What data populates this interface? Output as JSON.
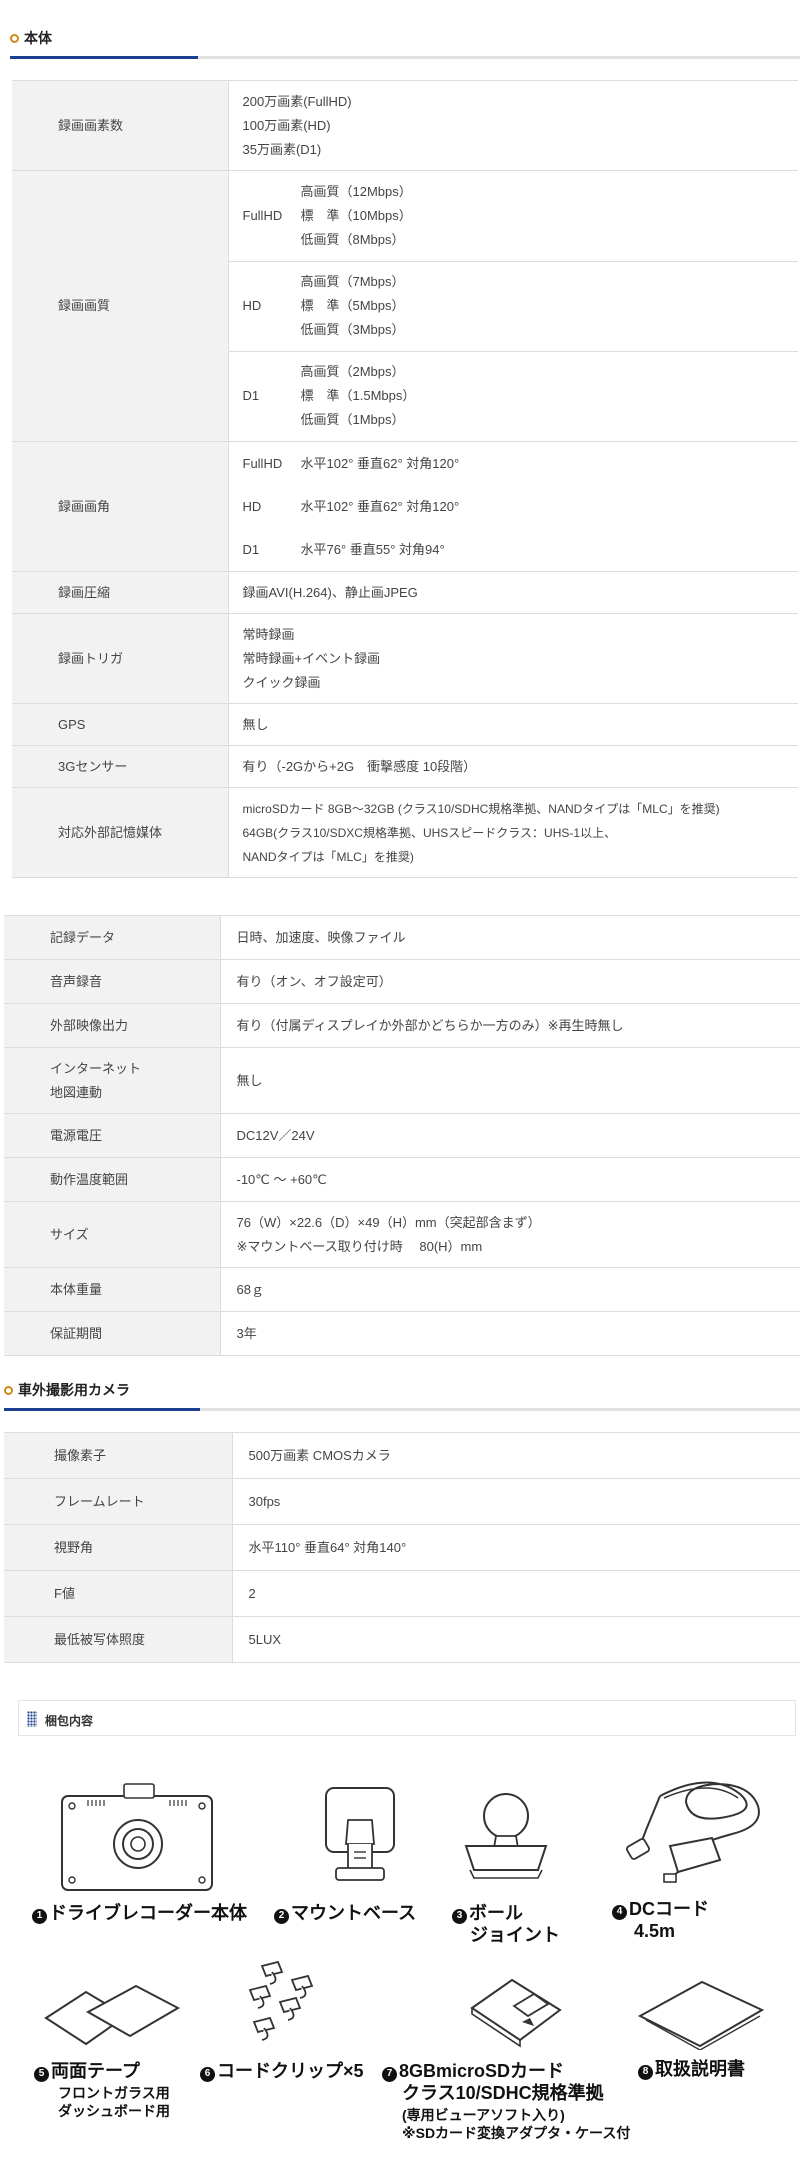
{
  "section_main": {
    "title": "本体"
  },
  "main_table": [
    {
      "label": "録画画素数",
      "lines": [
        "200万画素(FullHD)",
        "100万画素(HD)",
        "35万画素(D1)"
      ]
    },
    {
      "label": "録画画質",
      "groups": [
        {
          "mode": "FullHD",
          "lines": [
            "高画質（12Mbps）",
            "標　準（10Mbps）",
            "低画質（8Mbps）"
          ]
        },
        {
          "mode": "HD",
          "lines": [
            "高画質（7Mbps）",
            "標　準（5Mbps）",
            "低画質（3Mbps）"
          ]
        },
        {
          "mode": "D1",
          "lines": [
            "高画質（2Mbps）",
            "標　準（1.5Mbps）",
            "低画質（1Mbps）"
          ]
        }
      ]
    },
    {
      "label": "録画画角",
      "rows": [
        {
          "mode": "FullHD",
          "value": "水平102° 垂直62° 対角120°"
        },
        {
          "mode": "HD",
          "value": "水平102° 垂直62° 対角120°"
        },
        {
          "mode": "D1",
          "value": "水平76° 垂直55° 対角94°"
        }
      ]
    },
    {
      "label": "録画圧縮",
      "lines": [
        "録画AVI(H.264)、静止画JPEG"
      ]
    },
    {
      "label": "録画トリガ",
      "lines": [
        "常時録画",
        "常時録画+イベント録画",
        "クイック録画"
      ]
    },
    {
      "label": "GPS",
      "lines": [
        "無し"
      ]
    },
    {
      "label": "3Gセンサー",
      "lines": [
        "有り（-2Gから+2G　衝撃感度 10段階）"
      ]
    },
    {
      "label": "対応外部記憶媒体",
      "lines": [
        "microSDカード 8GB～32GB (クラス10/SDHC規格準拠、NANDタイプは「MLC」を推奨)",
        "64GB(クラス10/SDXC規格準拠、UHSスピードクラス：UHS-1以上、",
        "NANDタイプは「MLC」を推奨)"
      ]
    }
  ],
  "second_table": [
    {
      "label": "記録データ",
      "lines": [
        "日時、加速度、映像ファイル"
      ]
    },
    {
      "label": "音声録音",
      "lines": [
        "有り（オン、オフ設定可）"
      ]
    },
    {
      "label": "外部映像出力",
      "lines": [
        "有り（付属ディスプレイか外部かどちらか一方のみ）※再生時無し"
      ]
    },
    {
      "label_lines": [
        "インターネット",
        "地図連動"
      ],
      "lines": [
        "無し"
      ]
    },
    {
      "label": "電源電圧",
      "lines": [
        "DC12V／24V"
      ]
    },
    {
      "label": "動作温度範囲",
      "lines": [
        "-10℃ ～ +60℃"
      ]
    },
    {
      "label": "サイズ",
      "lines": [
        "76（W）×22.6（D）×49（H）mm（突起部含まず）",
        "※マウントベース取り付け時　 80(H）mm"
      ]
    },
    {
      "label": "本体重量",
      "lines": [
        "68ｇ"
      ]
    },
    {
      "label": "保証期間",
      "lines": [
        "3年"
      ]
    }
  ],
  "section_camera": {
    "title": "車外撮影用カメラ"
  },
  "camera_table": [
    {
      "label": "撮像素子",
      "value": "500万画素 CMOSカメラ"
    },
    {
      "label": "フレームレート",
      "value": "30fps"
    },
    {
      "label": "視野角",
      "value": "水平110° 垂直64° 対角140°"
    },
    {
      "label": "F値",
      "value": "2"
    },
    {
      "label": "最低被写体照度",
      "value": "5LUX"
    }
  ],
  "package": {
    "title": "梱包内容",
    "items": [
      {
        "num": "1",
        "name": "ドライブレコーダー本体",
        "icon": "dashcam-body-icon"
      },
      {
        "num": "2",
        "name": "マウントベース",
        "icon": "mount-base-icon"
      },
      {
        "num": "3",
        "name_lines": [
          "ボール",
          "ジョイント"
        ],
        "icon": "ball-joint-icon"
      },
      {
        "num": "4",
        "name_lines": [
          "DCコード",
          "4.5m"
        ],
        "icon": "dc-cord-icon"
      },
      {
        "num": "5",
        "name": "両面テープ",
        "sub_lines": [
          "フロントガラス用",
          "ダッシュボード用"
        ],
        "icon": "double-sided-tape-icon"
      },
      {
        "num": "6",
        "name": "コードクリップ×5",
        "icon": "cord-clip-icon"
      },
      {
        "num": "7",
        "name_lines": [
          "8GBmicroSDカード",
          "クラス10/SDHC規格準拠"
        ],
        "sub_lines": [
          "(専用ビューアソフト入り)",
          "※SDカード変換アダプタ・ケース付"
        ],
        "icon": "microsd-card-icon"
      },
      {
        "num": "8",
        "name": "取扱説明書",
        "icon": "manual-icon"
      }
    ]
  }
}
